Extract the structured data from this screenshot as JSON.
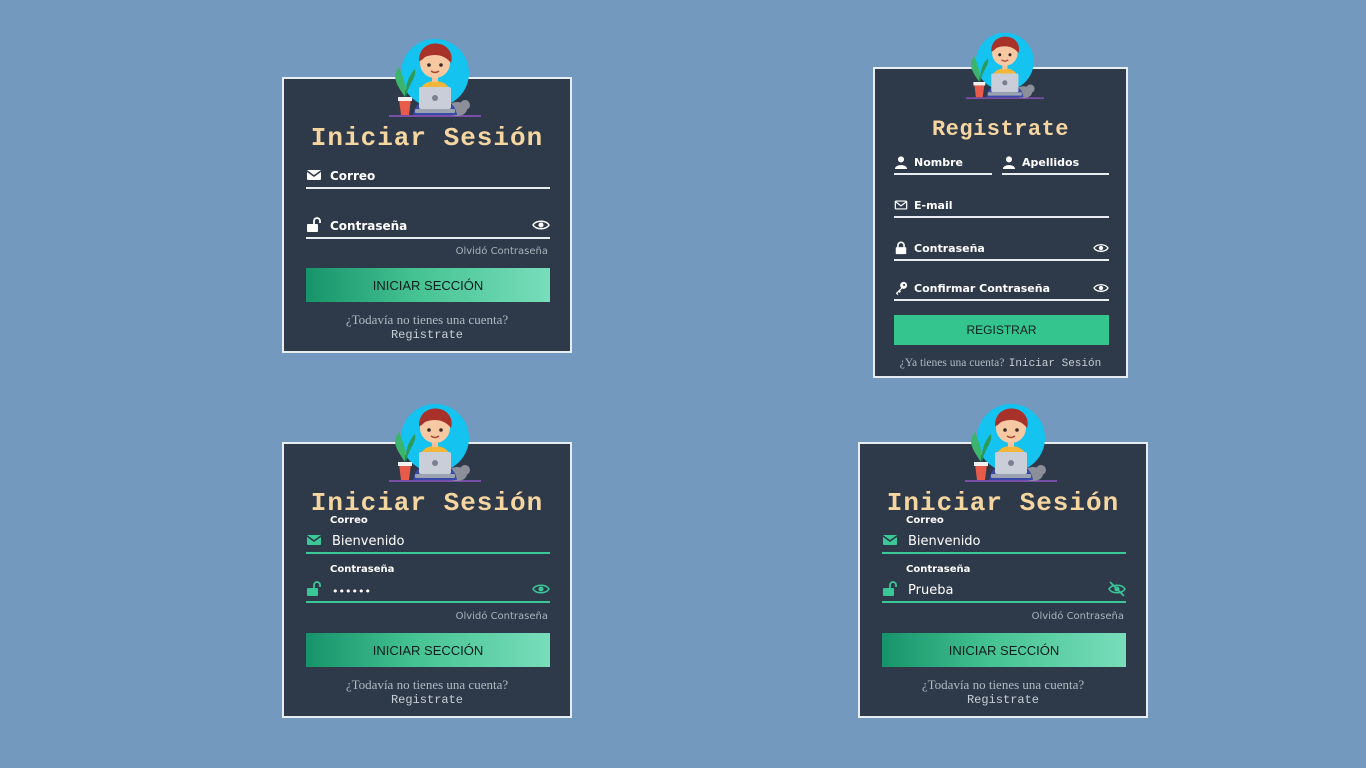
{
  "colors": {
    "background": "#7399be",
    "card": "#2e3a49",
    "title": "#f5d6a0",
    "accent": "#3ac897",
    "border": "#e8edf2"
  },
  "icons": {
    "mail": "mail-icon",
    "lock_open": "unlock-icon",
    "lock": "lock-icon",
    "user": "user-icon",
    "key": "key-icon",
    "eye": "eye-icon",
    "eye_off": "eye-off-icon",
    "avatar": "avatar-illustration"
  },
  "login1": {
    "title": "Iniciar Sesión",
    "email_label": "Correo",
    "password_label": "Contraseña",
    "forgot": "Olvidó Contraseña",
    "button": "INICIAR SECCIÓN",
    "no_account": "¿Todavía no tienes una cuenta?",
    "register_link": "Registrate"
  },
  "register": {
    "title": "Registrate",
    "first_name_label": "Nombre",
    "last_name_label": "Apellidos",
    "email_label": "E-mail",
    "password_label": "Contraseña",
    "confirm_label": "Confirmar Contraseña",
    "button": "REGISTRAR",
    "have_account": "¿Ya tienes una cuenta?",
    "login_link": "Iniciar Sesión"
  },
  "login2": {
    "title": "Iniciar Sesión",
    "email_label": "Correo",
    "email_value": "Bienvenido",
    "password_label": "Contraseña",
    "password_value": "••••••",
    "forgot": "Olvidó Contraseña",
    "button": "INICIAR SECCIÓN",
    "no_account": "¿Todavía no tienes una cuenta?",
    "register_link": "Registrate"
  },
  "login3": {
    "title": "Iniciar Sesión",
    "email_label": "Correo",
    "email_value": "Bienvenido",
    "password_label": "Contraseña",
    "password_value": "Prueba",
    "forgot": "Olvidó Contraseña",
    "button": "INICIAR SECCIÓN",
    "no_account": "¿Todavía no tienes una cuenta?",
    "register_link": "Registrate"
  }
}
